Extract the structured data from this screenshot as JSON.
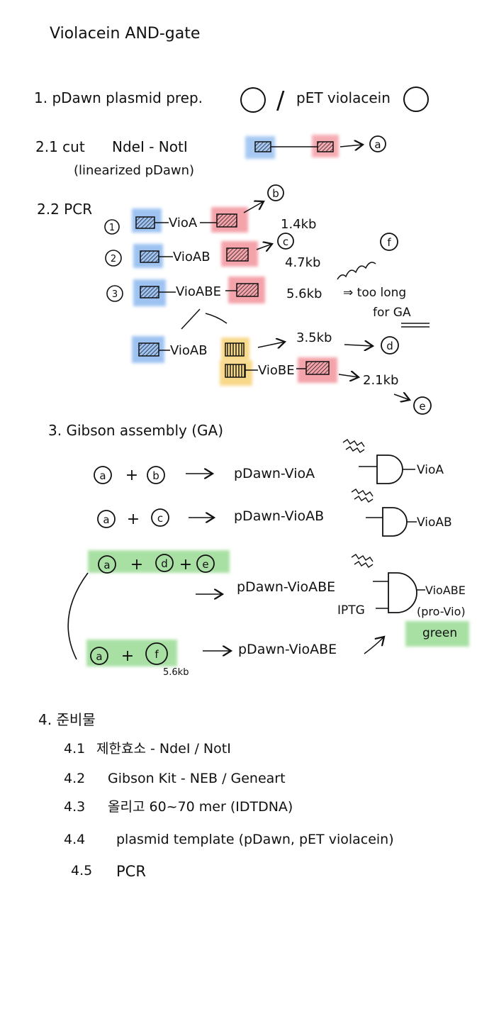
{
  "title": "Violacein AND-gate",
  "step1": {
    "label": "1. pDawn plasmid prep.",
    "sep": "/",
    "label2": "pET violacein"
  },
  "step2_1": {
    "label": "2.1 cut",
    "enzymes": "NdeI - NotI",
    "sub": "(linearized pDawn)",
    "out": "a"
  },
  "step2_2": {
    "label": "2.2 PCR",
    "rows": [
      {
        "num": "1",
        "gene": "VioA",
        "out": "b",
        "size": "1.4kb"
      },
      {
        "num": "2",
        "gene": "VioAB",
        "out": "c",
        "size": "4.7kb"
      },
      {
        "num": "3",
        "gene": "VioABE",
        "out": "f",
        "size": "5.6kb",
        "note1": "⇒ too long",
        "note2": "for GA"
      }
    ],
    "split": [
      {
        "gene": "VioAB",
        "size": "3.5kb",
        "out": "d"
      },
      {
        "gene": "VioBE",
        "size": "2.1kb",
        "out": "e"
      }
    ]
  },
  "step3": {
    "label": "3. Gibson assembly (GA)",
    "reactions": [
      {
        "inputs": [
          "a",
          "b"
        ],
        "product": "pDawn-VioA",
        "gate_out": "VioA"
      },
      {
        "inputs": [
          "a",
          "c"
        ],
        "product": "pDawn-VioAB",
        "gate_out": "VioAB"
      },
      {
        "inputs": [
          "a",
          "d",
          "e"
        ],
        "product": "pDawn-VioABE",
        "gate_out": "VioABE",
        "gate_in2": "IPTG",
        "gate_note": "(pro-Vio)",
        "gate_color": "green"
      },
      {
        "inputs": [
          "a",
          "f"
        ],
        "product": "pDawn-VioABE",
        "size_note": "5.6kb"
      }
    ]
  },
  "step4": {
    "label": "4. 준비물",
    "items": [
      {
        "num": "4.1",
        "text": "제한효소 - NdeI / NotI"
      },
      {
        "num": "4.2",
        "text": "Gibson Kit - NEB / Geneart"
      },
      {
        "num": "4.3",
        "text": "올리고 60~70 mer (IDTDNA)"
      },
      {
        "num": "4.4",
        "text": "plasmid template (pDawn, pET violacein)"
      },
      {
        "num": "4.5",
        "text": "PCR"
      }
    ]
  },
  "colors": {
    "blue": "#9ec3f2",
    "red": "#f4a3aa",
    "yellow": "#f8d98a",
    "green": "#a8e0a4",
    "ink": "#111111"
  }
}
